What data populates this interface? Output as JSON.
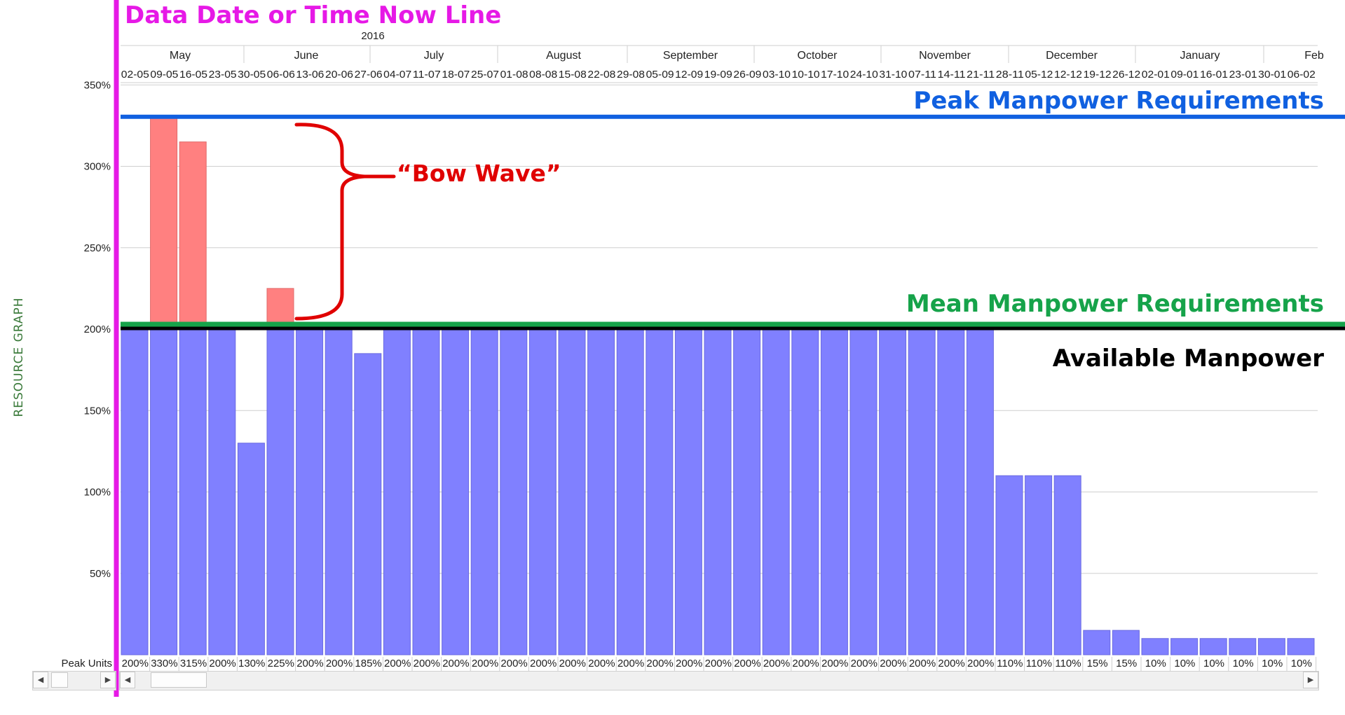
{
  "sidebar": {
    "label": "RESOURCE GRAPH"
  },
  "annotations": {
    "now_line": "Data Date or Time Now Line",
    "peak": "Peak Manpower Requirements",
    "mean": "Mean Manpower Requirements",
    "available": "Available Manpower",
    "bow_wave": "“Bow Wave”"
  },
  "colors": {
    "available_bar": "#8080ff",
    "over_bar": "#ff8080",
    "now_line": "#e619e6",
    "peak_line": "#1060e0",
    "mean_line": "#16a34a",
    "available_line": "#000000",
    "bow_wave": "#e00000"
  },
  "chart_data": {
    "type": "bar",
    "year": "2016",
    "months": [
      "May",
      "June",
      "July",
      "August",
      "September",
      "October",
      "November",
      "December",
      "January",
      "Feb"
    ],
    "categories": [
      "02-05",
      "09-05",
      "16-05",
      "23-05",
      "30-05",
      "06-06",
      "13-06",
      "20-06",
      "27-06",
      "04-07",
      "11-07",
      "18-07",
      "25-07",
      "01-08",
      "08-08",
      "15-08",
      "22-08",
      "29-08",
      "05-09",
      "12-09",
      "19-09",
      "26-09",
      "03-10",
      "10-10",
      "17-10",
      "24-10",
      "31-10",
      "07-11",
      "14-11",
      "21-11",
      "28-11",
      "05-12",
      "12-12",
      "19-12",
      "26-12",
      "02-01",
      "09-01",
      "16-01",
      "23-01",
      "30-01",
      "06-02"
    ],
    "values": [
      200,
      330,
      315,
      200,
      130,
      225,
      200,
      200,
      185,
      200,
      200,
      200,
      200,
      200,
      200,
      200,
      200,
      200,
      200,
      200,
      200,
      200,
      200,
      200,
      200,
      200,
      200,
      200,
      200,
      200,
      110,
      110,
      110,
      15,
      15,
      10,
      10,
      10,
      10,
      10,
      10
    ],
    "value_labels": [
      "200%",
      "330%",
      "315%",
      "200%",
      "130%",
      "225%",
      "200%",
      "200%",
      "185%",
      "200%",
      "200%",
      "200%",
      "200%",
      "200%",
      "200%",
      "200%",
      "200%",
      "200%",
      "200%",
      "200%",
      "200%",
      "200%",
      "200%",
      "200%",
      "200%",
      "200%",
      "200%",
      "200%",
      "200%",
      "200%",
      "110%",
      "110%",
      "110%",
      "15%",
      "15%",
      "10%",
      "10%",
      "10%",
      "10%",
      "10%",
      "10%"
    ],
    "available_limit": 200,
    "mean_requirement": 203,
    "peak_requirement": 330,
    "row_label": "Peak Units",
    "ylim": [
      0,
      370
    ],
    "yticks": [
      50,
      100,
      150,
      200,
      250,
      300,
      350
    ],
    "ytick_labels": [
      "50%",
      "100%",
      "150%",
      "200%",
      "250%",
      "300%",
      "350%"
    ],
    "grid": true
  }
}
